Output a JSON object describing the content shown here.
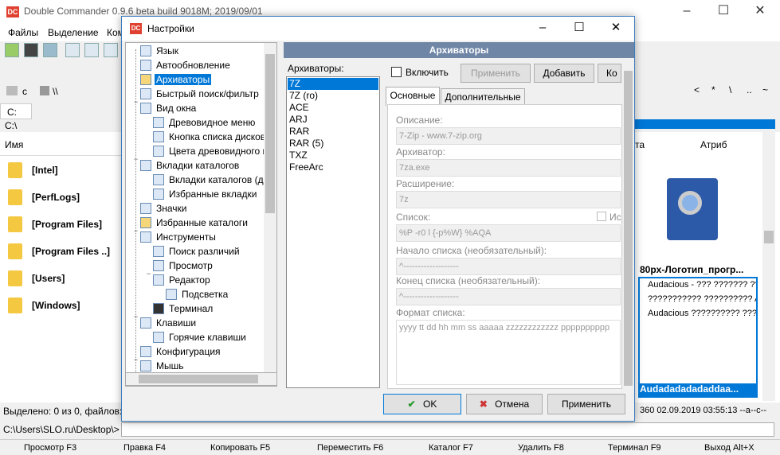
{
  "main_window": {
    "title": "Double Commander 0.9.6 beta build 9018M; 2019/09/01",
    "menu": [
      "Файлы",
      "Выделение",
      "Ком"
    ],
    "drive_tab_label": "c",
    "network_label": "\\\\",
    "left_panel_tab": "C:",
    "left_panel_path": "C:\\",
    "column_name": "Имя",
    "column_date": "та",
    "column_attr": "Атриб",
    "folders": [
      "[Intel]",
      "[PerfLogs]",
      "[Program Files]",
      "[Program Files ..]",
      "[Users]",
      "[Windows]"
    ],
    "status_left": "Выделено: 0 из 0, файлов: 0",
    "preview_title": "80px-Логотип_прогр...",
    "preview_lines": [
      "Audacious - ??? ??????? ??",
      "??????????? ?????????? Au",
      "Audacious ?????????? ???"
    ],
    "preview_footer": "Audadadadadaddaa...",
    "status_right": "360  02.09.2019 03:55:13  --a--c--",
    "command_path": "C:\\Users\\SLO.ru\\Desktop\\>",
    "fkeys": [
      "Просмотр F3",
      "Правка F4",
      "Копировать F5",
      "Переместить F6",
      "Каталог F7",
      "Удалить F8",
      "Терминал F9",
      "Выход Alt+X"
    ]
  },
  "dialog": {
    "title": "Настройки",
    "tree": [
      {
        "label": "Язык",
        "icon": "language-icon"
      },
      {
        "label": "Автообновление",
        "icon": "autorefresh-icon"
      },
      {
        "label": "Архиваторы",
        "icon": "archive-icon",
        "selected": true
      },
      {
        "label": "Быстрый поиск/фильтр",
        "icon": "search-filter-icon"
      },
      {
        "label": "Вид окна",
        "icon": "window-view-icon"
      },
      {
        "label": "Древовидное меню",
        "icon": "tree-menu-icon"
      },
      {
        "label": "Кнопка списка дисков",
        "icon": "drive-button-icon"
      },
      {
        "label": "Цвета древовидного м",
        "icon": "colors-icon"
      },
      {
        "label": "Вкладки каталогов",
        "icon": "folder-tabs-icon"
      },
      {
        "label": "Вкладки каталогов (до",
        "icon": "folder-tabs-extra-icon"
      },
      {
        "label": "Избранные вкладки",
        "icon": "favorite-tabs-icon"
      },
      {
        "label": "Значки",
        "icon": "icons-icon"
      },
      {
        "label": "Избранные каталоги",
        "icon": "favorite-folders-icon"
      },
      {
        "label": "Инструменты",
        "icon": "tools-icon"
      },
      {
        "label": "Поиск различий",
        "icon": "diff-icon"
      },
      {
        "label": "Просмотр",
        "icon": "viewer-icon"
      },
      {
        "label": "Редактор",
        "icon": "editor-icon"
      },
      {
        "label": "Подсветка",
        "icon": "highlight-icon"
      },
      {
        "label": "Терминал",
        "icon": "terminal-icon"
      },
      {
        "label": "Клавиши",
        "icon": "keyboard-icon"
      },
      {
        "label": "Горячие клавиши",
        "icon": "hotkeys-icon"
      },
      {
        "label": "Конфигурация",
        "icon": "config-icon"
      },
      {
        "label": "Мышь",
        "icon": "mouse-icon"
      }
    ],
    "header": "Архиваторы",
    "list_label": "Архиваторы:",
    "archivers": [
      "7Z",
      "7Z (ro)",
      "ACE",
      "ARJ",
      "RAR",
      "RAR (5)",
      "TXZ",
      "FreeArc"
    ],
    "enable_label": "Включить",
    "apply_button": "Применить",
    "add_button": "Добавить",
    "copy_button": "Ко",
    "tab_main": "Основные",
    "tab_extra": "Дополнительные",
    "fields": {
      "description_label": "Описание:",
      "description_value": "7-Zip - www.7-zip.org",
      "archiver_label": "Архиватор:",
      "archiver_value": "7za.exe",
      "extension_label": "Расширение:",
      "extension_value": "7z",
      "list_label": "Список:",
      "list_value": "%P -r0 l {-p%W} %AQA",
      "list_check_label": "Ис",
      "list_start_label": "Начало списка (необязательный):",
      "list_start_value": "^-------------------",
      "list_end_label": "Конец списка (необязательный):",
      "list_end_value": "^-------------------",
      "format_label": "Формат списка:",
      "format_value": "yyyy tt dd hh mm ss aaaaa zzzzzzzzzzzz pppppppppp"
    },
    "ok_button": "OK",
    "cancel_button": "Отмена",
    "apply_bottom_button": "Применить"
  }
}
